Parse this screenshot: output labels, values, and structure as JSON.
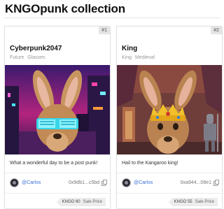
{
  "page": {
    "title": "KNGOpunk collection"
  },
  "cards": [
    {
      "rank": "#1",
      "title": "Cyberpunk2047",
      "tags": [
        "Future",
        "Glasses"
      ],
      "description": "What a wonderful day to be a post punk!",
      "owner": "@Carlos",
      "address": "0x9db1...c5bd",
      "price": "KNGO 60",
      "price_label": "Sale Price"
    },
    {
      "rank": "#2",
      "title": "King",
      "tags": [
        "King",
        "Medieval"
      ],
      "description": "Hail to the Kangaroo king!",
      "owner": "@Carlos",
      "address": "0xa944...08e1",
      "price": "KNGO 55",
      "price_label": "Sale Price"
    }
  ]
}
